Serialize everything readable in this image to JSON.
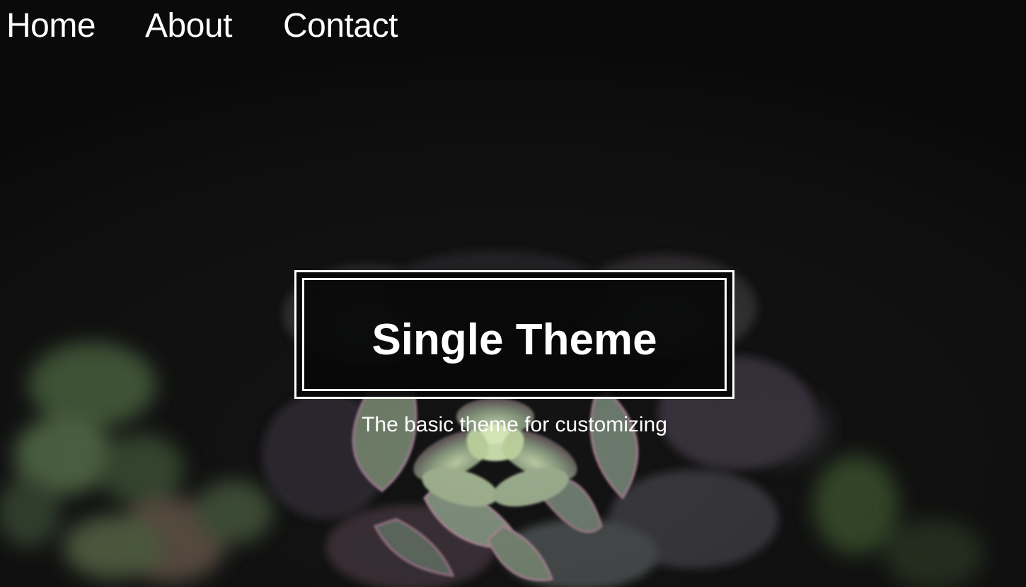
{
  "nav": {
    "items": [
      {
        "label": "Home"
      },
      {
        "label": "About"
      },
      {
        "label": "Contact"
      }
    ]
  },
  "hero": {
    "title": "Single Theme",
    "tagline": "The basic theme for customizing",
    "background_image": "succulent-photo"
  },
  "colors": {
    "nav_background": "#0a0a0a",
    "page_background": "#131313",
    "text": "#ffffff",
    "title_box_border": "#ffffff"
  }
}
